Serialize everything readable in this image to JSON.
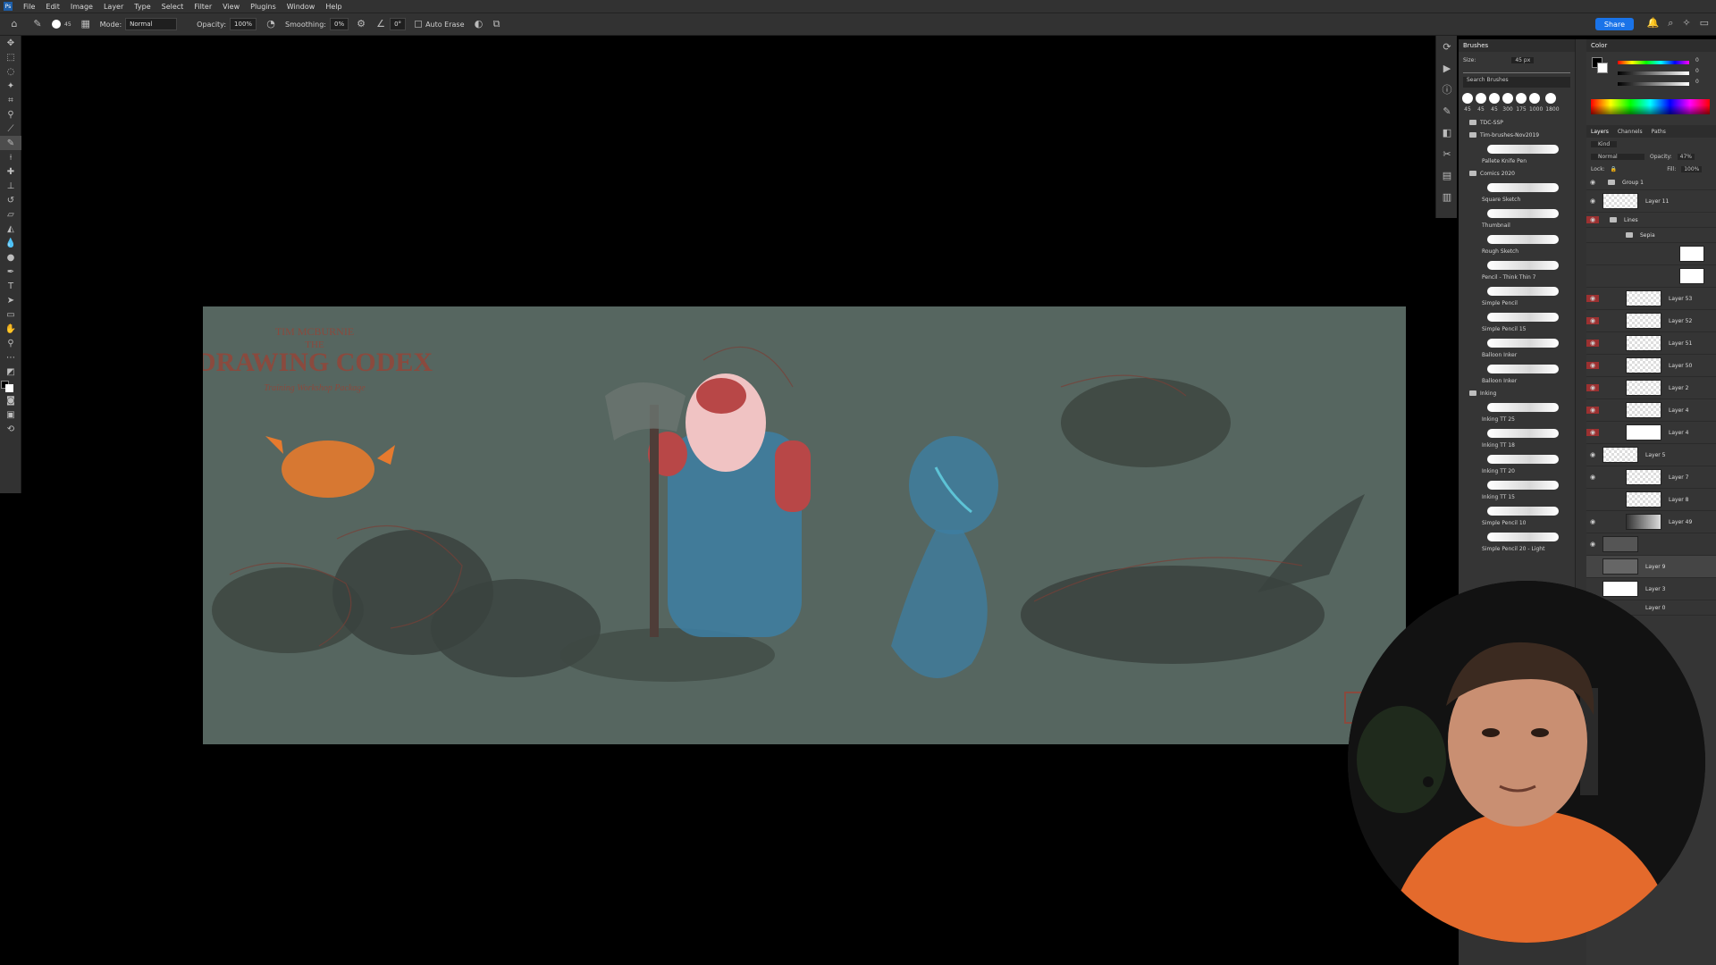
{
  "menu": {
    "items": [
      "File",
      "Edit",
      "Image",
      "Layer",
      "Type",
      "Select",
      "Filter",
      "View",
      "Plugins",
      "Window",
      "Help"
    ]
  },
  "options": {
    "mode_label": "Mode:",
    "mode_value": "Normal",
    "opacity_label": "Opacity:",
    "opacity_value": "100%",
    "smoothing_label": "Smoothing:",
    "smoothing_value": "0%",
    "angle_value": "0°",
    "auto_erase": "Auto Erase",
    "share_label": "Share",
    "brush_size": "45"
  },
  "brushes": {
    "title": "Brushes",
    "size_label": "Size:",
    "size_value": "45 px",
    "search_placeholder": "Search Brushes",
    "presets": [
      "45",
      "45",
      "45",
      "300",
      "175",
      "1000",
      "1800"
    ],
    "groups": [
      {
        "name": "TDC-SSP"
      },
      {
        "name": "Tim-brushes-Nov2019"
      }
    ],
    "top_item": "Pallete Knife Pen",
    "comics_group": "Comics 2020",
    "comics_items": [
      "Square Sketch",
      "Thumbnail",
      "Rough Sketch",
      "Pencil - Think Thin 7",
      "Simple Pencil",
      "Simple Pencil 15",
      "Balloon Inker",
      "Balloon Inker"
    ],
    "inking_group": "Inking",
    "inking_items": [
      "Inking TT 25",
      "Inking TT 18",
      "Inking TT 20",
      "Inking TT 15",
      "Simple Pencil 10",
      "Simple Pencil 20 - Light"
    ]
  },
  "color": {
    "title": "Color",
    "fields": [
      "0",
      "0",
      "0"
    ]
  },
  "layers": {
    "tabs": [
      "Layers",
      "Channels",
      "Paths"
    ],
    "kind_label": "Kind",
    "blend_mode": "Normal",
    "opacity_label": "Opacity:",
    "opacity_value": "47%",
    "lock_label": "Lock:",
    "fill_label": "Fill:",
    "fill_value": "100%",
    "rows": [
      "Group 1",
      "Layer 11",
      "Lines",
      "Sepia",
      "",
      "",
      "Layer 53",
      "Layer 52",
      "Layer 51",
      "Layer 50",
      "Layer 2",
      "Layer 4",
      "Layer 4",
      "Layer 5",
      "Layer 7",
      "Layer 8",
      "Layer 49",
      "",
      "Layer 9",
      "Layer 3",
      "Layer 0"
    ]
  },
  "artwork": {
    "logo_top": "TIM MCBURNIE",
    "logo_mid": "THE",
    "logo_title": "DRAWING CODEX",
    "logo_sub": "Training  Workshop  Package",
    "bg_color": "#566660",
    "accent_colors": [
      "#e67a2e",
      "#b84747",
      "#3d7fa3",
      "#5dc3d6",
      "#f0c3c3"
    ]
  }
}
